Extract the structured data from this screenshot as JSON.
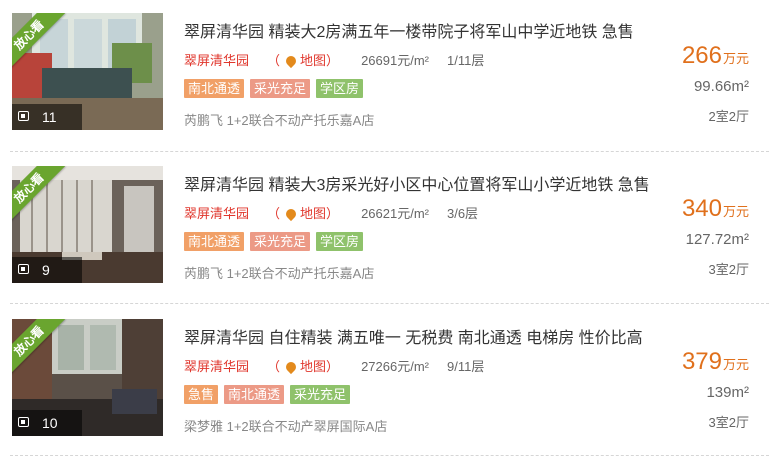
{
  "colors": {
    "price": "#e0701c",
    "estate_link": "#e0362c",
    "ribbon": "#6aa52f",
    "tag_orange": "#f1a067",
    "tag_salmon": "#ec9a86",
    "tag_green": "#8fc26b"
  },
  "listings": [
    {
      "ribbon": "放心看",
      "photo_count": "11",
      "title": "翠屏清华园 精装大2房满五年一楼带院子将军山中学近地铁 急售",
      "estate": "翠屏清华园",
      "map_link": "地图",
      "map_open": "（",
      "map_close": "）",
      "unit_price": "26691元/m²",
      "floor": "1/11层",
      "tags": [
        "南北通透",
        "采光充足",
        "学区房"
      ],
      "agent": "芮鹏飞 1+2联合不动产托乐嘉A店",
      "price": "266",
      "price_unit": "万元",
      "area": "99.66m²",
      "layout": "2室2厅"
    },
    {
      "ribbon": "放心看",
      "photo_count": "9",
      "title": "翠屏清华园 精装大3房采光好小区中心位置将军山小学近地铁 急售",
      "estate": "翠屏清华园",
      "map_link": "地图",
      "map_open": "（",
      "map_close": "）",
      "unit_price": "26621元/m²",
      "floor": "3/6层",
      "tags": [
        "南北通透",
        "采光充足",
        "学区房"
      ],
      "agent": "芮鹏飞 1+2联合不动产托乐嘉A店",
      "price": "340",
      "price_unit": "万元",
      "area": "127.72m²",
      "layout": "3室2厅"
    },
    {
      "ribbon": "放心看",
      "photo_count": "10",
      "title": "翠屏清华园 自住精装 满五唯一 无税费 南北通透 电梯房 性价比高",
      "estate": "翠屏清华园",
      "map_link": "地图",
      "map_open": "（",
      "map_close": "）",
      "unit_price": "27266元/m²",
      "floor": "9/11层",
      "tags": [
        "急售",
        "南北通透",
        "采光充足"
      ],
      "agent": "梁梦雅 1+2联合不动产翠屏国际A店",
      "price": "379",
      "price_unit": "万元",
      "area": "139m²",
      "layout": "3室2厅"
    }
  ]
}
